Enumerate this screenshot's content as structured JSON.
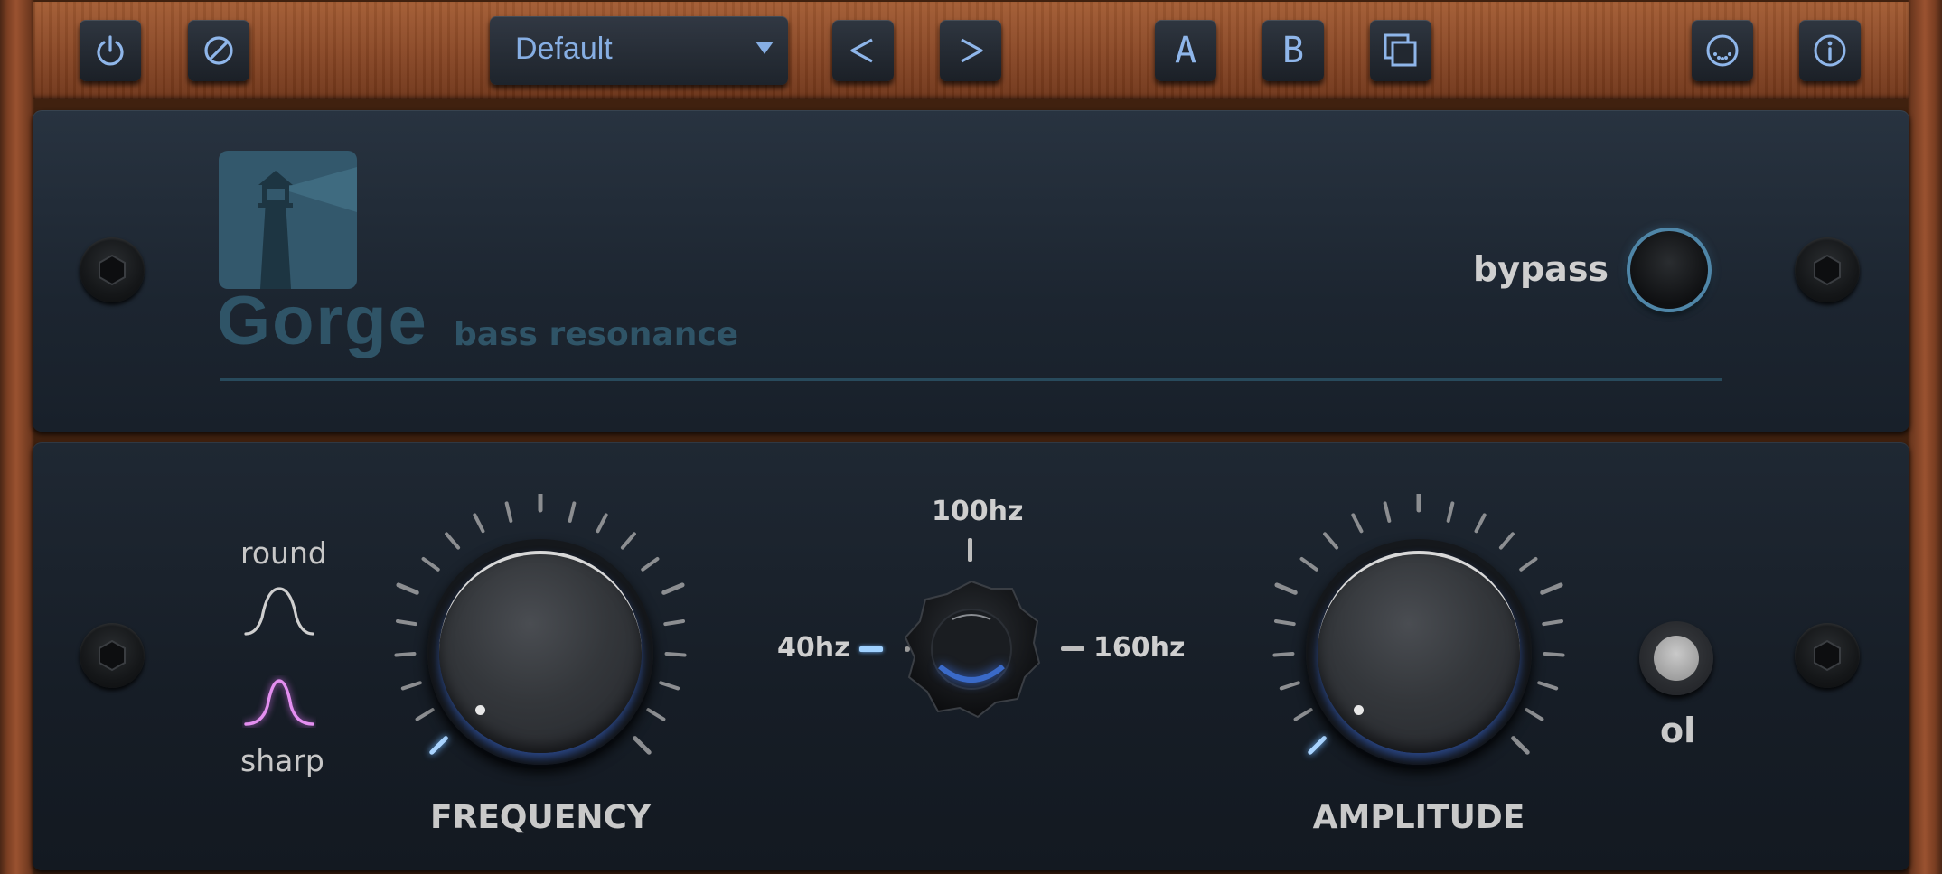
{
  "toolbar": {
    "preset_value": "Default",
    "prev_label": "<",
    "next_label": ">",
    "a_label": "A",
    "b_label": "B",
    "icons": [
      "power-icon",
      "bypass-slash-icon",
      "prev-icon",
      "next-icon",
      "copy-icon",
      "community-icon",
      "info-icon"
    ]
  },
  "header": {
    "brand": "Gorge",
    "subtitle": "bass resonance",
    "bypass_label": "bypass"
  },
  "controls": {
    "shape_round": "round",
    "shape_sharp": "sharp",
    "frequency_label": "FREQUENCY",
    "amplitude_label": "AMPLITUDE",
    "range_low": "40hz",
    "range_mid": "100hz",
    "range_high": "160hz",
    "ol_label": "ol",
    "selected_shape": "sharp",
    "selected_range": "100hz"
  },
  "colors": {
    "accent": "#8fb6ea",
    "brand": "#2f5467",
    "sharp_active": "#e48ff0",
    "knob_glow": "#3c6edc"
  }
}
